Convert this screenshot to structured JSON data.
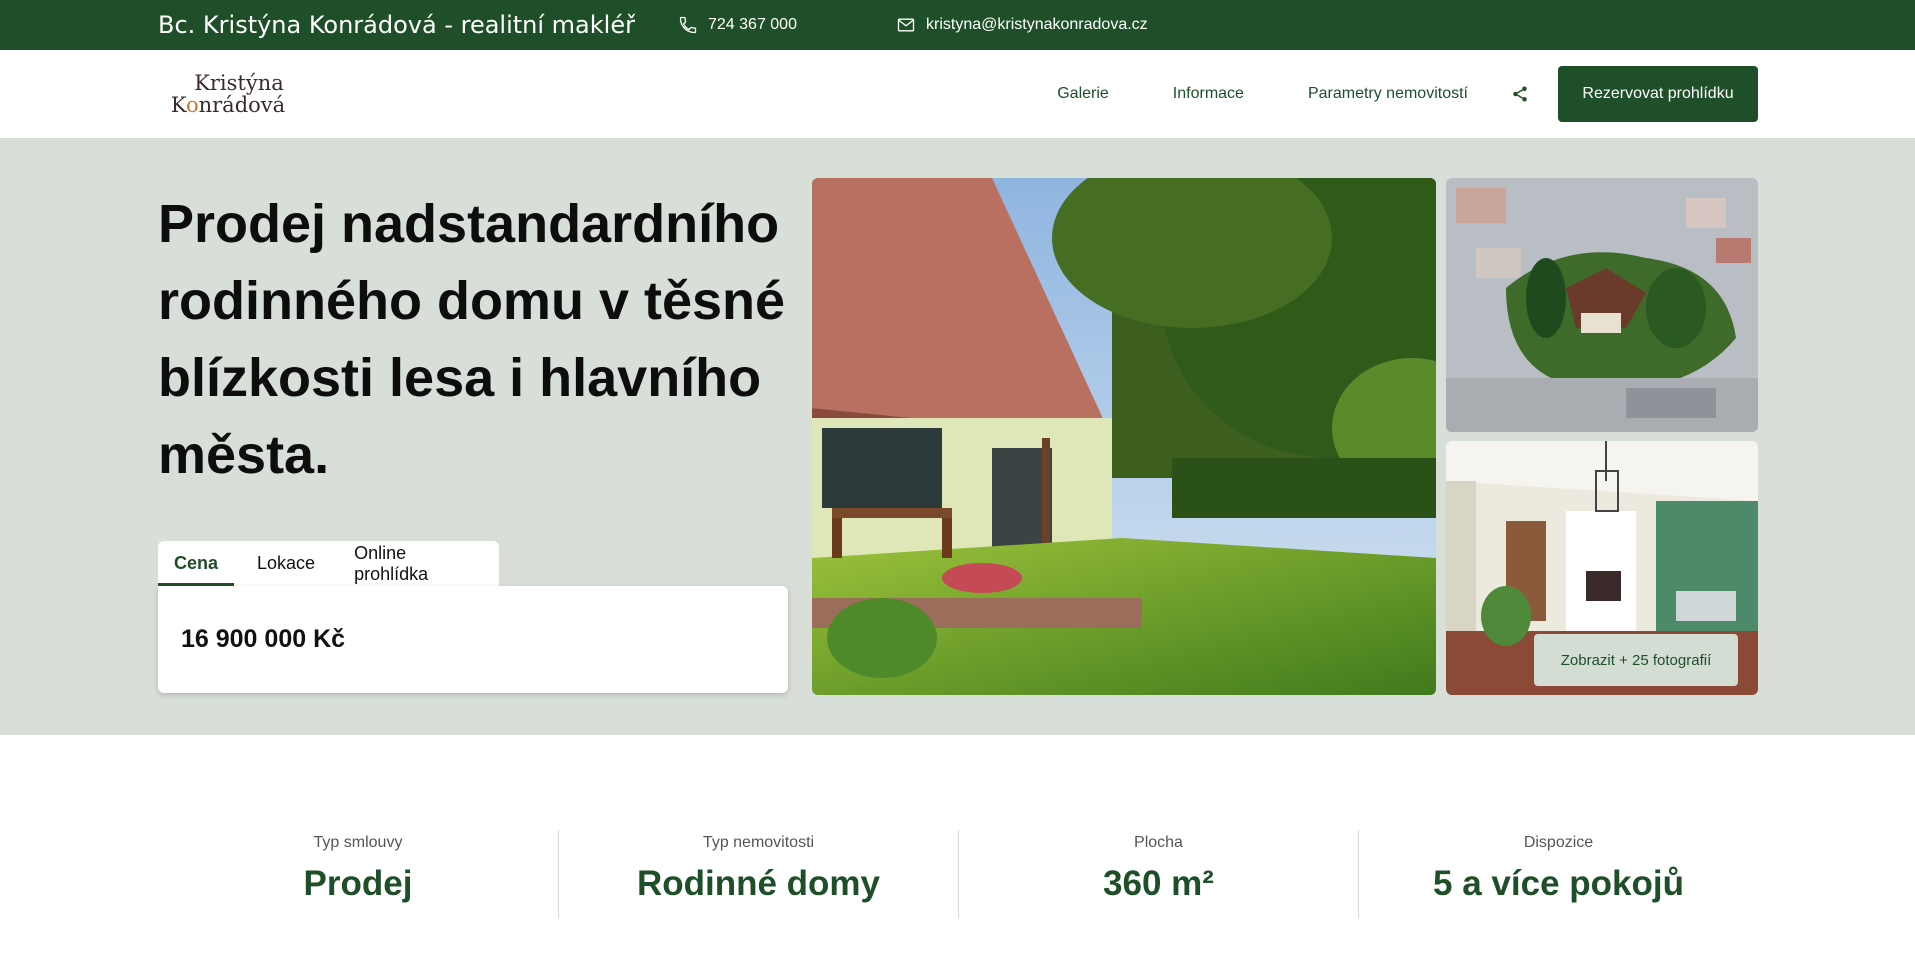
{
  "topbar": {
    "brand": "Bc. Kristýna Konrádová - realitní makléř",
    "phone": "724 367 000",
    "email": "kristyna@kristynakonradova.cz"
  },
  "logo": {
    "line1": "Kristýna",
    "line2_a": "K",
    "line2_o": "o",
    "line2_b": "nrádová"
  },
  "nav": {
    "items": [
      {
        "label": "Galerie"
      },
      {
        "label": "Informace"
      },
      {
        "label": "Parametry nemovitostí"
      }
    ],
    "share_icon": "share-icon",
    "cta": "Rezervovat prohlídku"
  },
  "hero": {
    "title": "Prodej nadstandardního rodinného domu v těsné blízkosti lesa i hlavního města.",
    "tabs": [
      {
        "label": "Cena",
        "active": true
      },
      {
        "label": "Lokace",
        "active": false
      },
      {
        "label": "Online prohlídka",
        "active": false
      }
    ],
    "price": "16 900 000 Kč",
    "more_photos": "Zobrazit + 25 fotografií"
  },
  "params": [
    {
      "label": "Typ smlouvy",
      "value": "Prodej"
    },
    {
      "label": "Typ nemovitosti",
      "value": "Rodinné domy"
    },
    {
      "label": "Plocha",
      "value": "360 m²"
    },
    {
      "label": "Dispozice",
      "value": "5 a více pokojů"
    }
  ],
  "colors": {
    "brand_green": "#1f4f28",
    "hero_bg": "#d7dfd8"
  }
}
